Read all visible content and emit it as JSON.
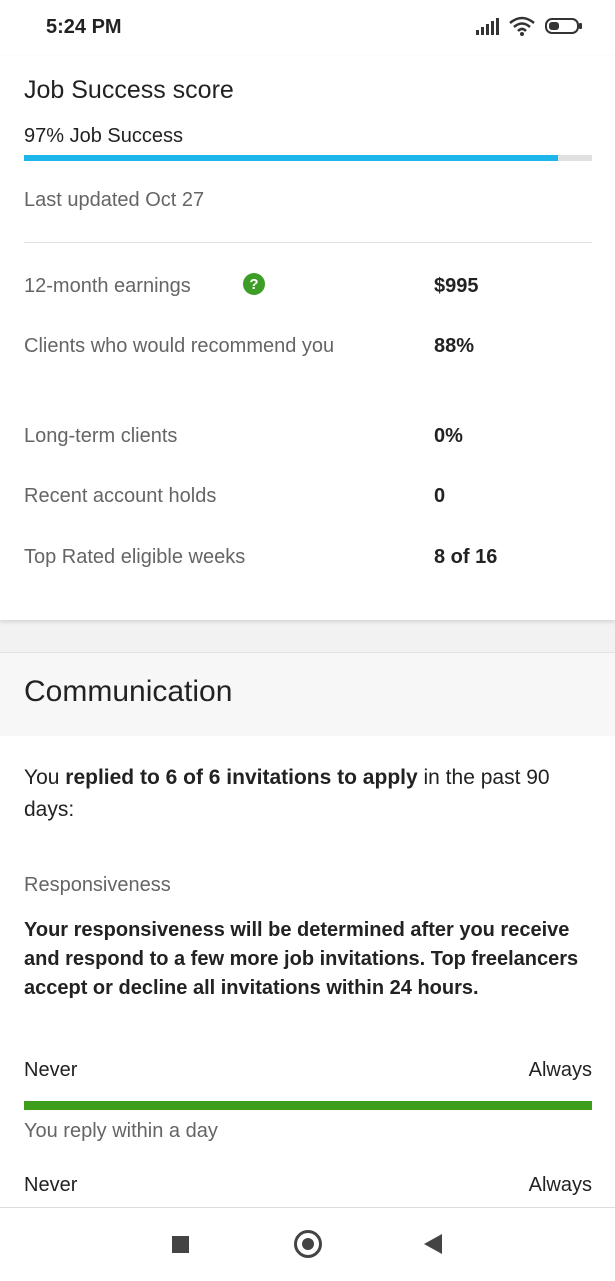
{
  "status_bar": {
    "time": "5:24 PM",
    "icons": [
      "signal-icon",
      "wifi-icon",
      "battery-icon"
    ]
  },
  "job_success": {
    "title": "Job Success score",
    "score_text": "97% Job Success",
    "progress": 0.94,
    "last_updated": "Last updated Oct 27",
    "accent_color": "#1cb6ea"
  },
  "stats": [
    {
      "label": "12-month earnings",
      "value": "$995",
      "has_help": true
    },
    {
      "label": "Clients who would recommend you",
      "value": "88%"
    },
    {
      "label": "Long-term clients",
      "value": "0%"
    },
    {
      "label": "Recent account holds",
      "value": "0"
    },
    {
      "label": "Top Rated eligible weeks",
      "value": "8 of 16"
    }
  ],
  "communication": {
    "title": "Communication",
    "replied_prefix": "You ",
    "replied_bold": "replied to 6 of 6 invitations to apply",
    "replied_suffix": " in the past 90 days:",
    "responsiveness_label": "Responsiveness",
    "responsiveness_note": "Your responsiveness will be determined after you receive and respond to a few more job invitations. Top freelancers accept or decline all invitations within 24 hours.",
    "scale_min": "Never",
    "scale_max": "Always",
    "reply_speed": "You reply within a day",
    "reply_level": 1.0,
    "bar_color": "#3c9e1a",
    "scale2_min": "Never",
    "scale2_max": "Always"
  },
  "nav": {
    "icons": [
      "recent-apps-icon",
      "home-icon",
      "back-icon"
    ]
  }
}
